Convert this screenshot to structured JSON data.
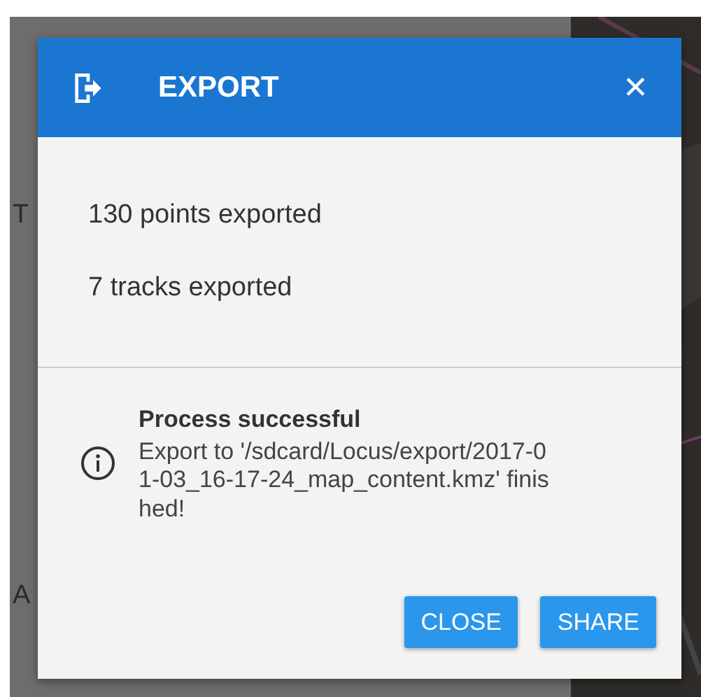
{
  "background": {
    "labels": [
      "T",
      "A"
    ]
  },
  "dialog": {
    "title": "EXPORT",
    "close_icon": "✕",
    "lines": [
      "130 points exported",
      "7 tracks exported"
    ],
    "message": {
      "title": "Process successful",
      "text": "Export to '/sdcard/Locus/export/2017-01-03_16-17-24_map_content.kmz' finished!"
    },
    "buttons": [
      "CLOSE",
      "SHARE"
    ]
  }
}
